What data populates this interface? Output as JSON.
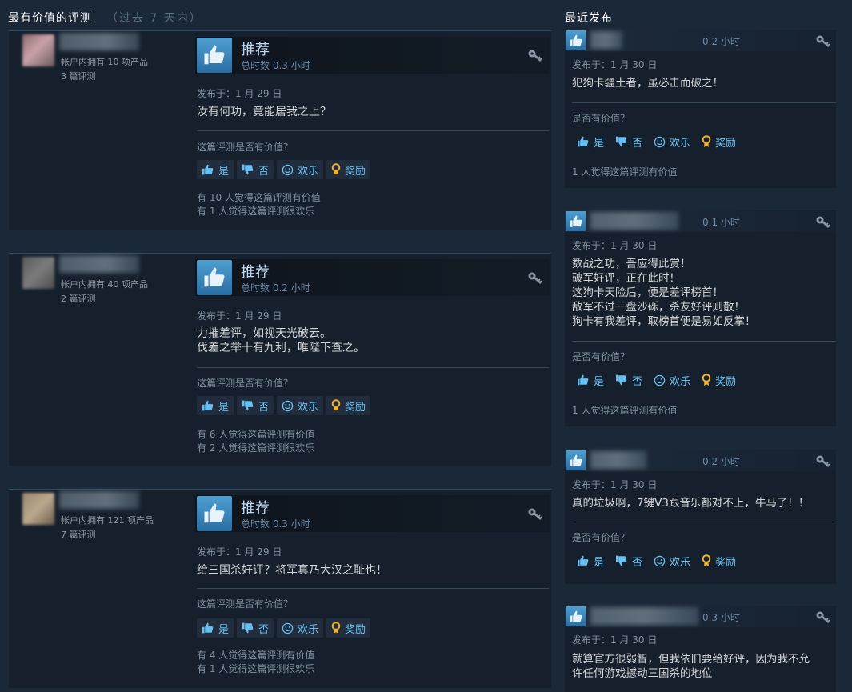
{
  "sections": {
    "helpful_title": "最有价值的评测",
    "helpful_range": "（过去 7 天内）",
    "recent_title": "最近发布"
  },
  "helpful_reviews": [
    {
      "owned": "帐户内拥有 10 项产品",
      "review_count": "3 篇评测",
      "verdict": "推荐",
      "hours": "总时数 0.3 小时",
      "posted": "发布于：1 月 29 日",
      "text": [
        "汝有何功，竟能居我之上？"
      ],
      "helpful_question": "这篇评测是否有价值？",
      "stat_helpful": "有 10 人觉得这篇评测有价值",
      "stat_funny": "有 1 人觉得这篇评测很欢乐"
    },
    {
      "owned": "帐户内拥有 40 项产品",
      "review_count": "2 篇评测",
      "verdict": "推荐",
      "hours": "总时数 0.2 小时",
      "posted": "发布于：1 月 29 日",
      "text": [
        "力摧差评，如视天光破云。",
        "伐差之举十有九利，唯陛下查之。"
      ],
      "helpful_question": "这篇评测是否有价值？",
      "stat_helpful": "有 6 人觉得这篇评测有价值",
      "stat_funny": "有 2 人觉得这篇评测很欢乐"
    },
    {
      "owned": "帐户内拥有 121 项产品",
      "review_count": "7 篇评测",
      "verdict": "推荐",
      "hours": "总时数 0.3 小时",
      "posted": "发布于：1 月 29 日",
      "text": [
        "给三国杀好评？将军真乃大汉之耻也！"
      ],
      "helpful_question": "这篇评测是否有价值？",
      "stat_helpful": "有 4 人觉得这篇评测有价值",
      "stat_funny": "有 1 人觉得这篇评测很欢乐"
    }
  ],
  "buttons": {
    "yes": "是",
    "no": "否",
    "funny": "欢乐",
    "award": "奖励"
  },
  "recent_reviews": [
    {
      "hours": "0.2 小时",
      "posted": "发布于：1 月 30 日",
      "text": [
        "犯狗卡疆土者，虽必击而破之！"
      ],
      "helpful_question": "是否有价值？",
      "stat": "1 人觉得这篇评测有价值"
    },
    {
      "hours": "0.1 小时",
      "posted": "发布于：1 月 30 日",
      "text": [
        "数战之功，吾应得此赏！",
        "破军好评，正在此时！",
        "这狗卡天险后，便是差评榜首！",
        "敌军不过一盘沙砾，杀友好评则散！",
        "狗卡有我差评，取榜首便是易如反掌！"
      ],
      "helpful_question": "是否有价值？",
      "stat": "1 人觉得这篇评测有价值"
    },
    {
      "hours": "0.2 小时",
      "posted": "发布于：1 月 30 日",
      "text": [
        "真的垃圾啊，7键V3跟音乐都对不上，牛马了！！"
      ],
      "helpful_question": "是否有价值？",
      "stat": ""
    },
    {
      "hours": "0.3 小时",
      "posted": "发布于：1 月 30 日",
      "text": [
        "就算官方很弱智，但我依旧要给好评，因为我不允",
        "许任何游戏撼动三国杀的地位"
      ],
      "helpful_question": "",
      "stat": ""
    }
  ],
  "colors": {
    "accent": "#66c0f4",
    "background": "#1b2838",
    "card": "#16202d"
  }
}
